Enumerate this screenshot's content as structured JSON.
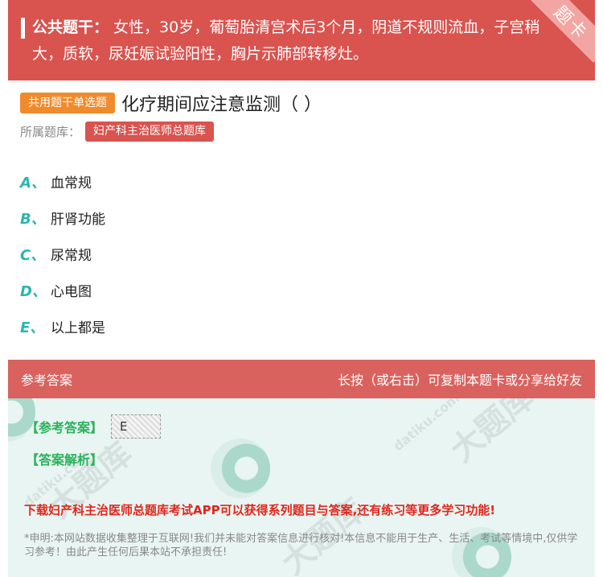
{
  "stem": {
    "label": "公共题干：",
    "text": "女性，30岁，葡萄胎清宫术后3个月，阴道不规则流血，子宫稍大，质软，尿妊娠试验阳性，胸片示肺部转移灶。",
    "corner_label": "题卡"
  },
  "question": {
    "tag": "共用题干单选题",
    "title": "化疗期间应注意监测（ ）"
  },
  "library": {
    "label": "所属题库：",
    "name": "妇产科主治医师总题库"
  },
  "options": [
    {
      "letter": "A、",
      "text": "血常规"
    },
    {
      "letter": "B、",
      "text": "肝肾功能"
    },
    {
      "letter": "C、",
      "text": "尿常规"
    },
    {
      "letter": "D、",
      "text": "心电图"
    },
    {
      "letter": "E、",
      "text": "以上都是"
    }
  ],
  "answer": {
    "header_left": "参考答案",
    "header_right": "长按（或右击）可复制本题卡或分享给好友",
    "key_label": "【参考答案】",
    "key_value": "E",
    "analysis_label": "【答案解析】",
    "promo": "下载妇产科主治医师总题库考试APP可以获得系列题目与答案,还有练习等更多学习功能!",
    "disclaimer": "*申明:本网站数据收集整理于互联网!我们并未能对答案信息进行核对!本信息不能用于生产、生活、考试等情境中,仅供学习参考！由此产生任何后果本站不承担责任!"
  },
  "watermark": {
    "text": "大题库",
    "domain": "datiku.com"
  },
  "colors": {
    "stem_bg": "#d9534f",
    "tag_orange": "#f08b2c",
    "option_letter": "#2bb5b0",
    "answer_green": "#2bb25c",
    "promo_red": "#e0261d"
  }
}
